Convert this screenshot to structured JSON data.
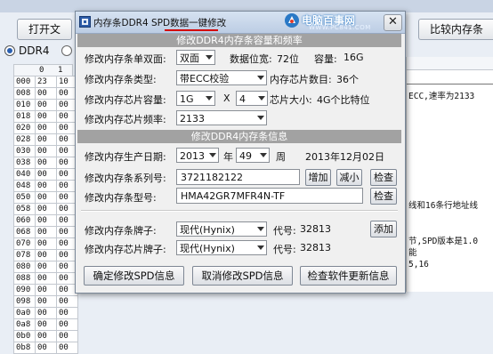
{
  "background": {
    "open_button": "打开文",
    "compare_button": "比较内存条",
    "ddr4_radio": "DDR4",
    "hex_header_cols": [
      "0",
      "1"
    ],
    "hex_rows": [
      [
        "000",
        "23",
        "10"
      ],
      [
        "008",
        "00",
        "00"
      ],
      [
        "010",
        "00",
        "00"
      ],
      [
        "018",
        "00",
        "00"
      ],
      [
        "020",
        "00",
        "00"
      ],
      [
        "028",
        "00",
        "00"
      ],
      [
        "030",
        "00",
        "00"
      ],
      [
        "038",
        "00",
        "00"
      ],
      [
        "040",
        "00",
        "00"
      ],
      [
        "048",
        "00",
        "00"
      ],
      [
        "050",
        "00",
        "00"
      ],
      [
        "058",
        "00",
        "00"
      ],
      [
        "060",
        "00",
        "00"
      ],
      [
        "068",
        "00",
        "00"
      ],
      [
        "070",
        "00",
        "00"
      ],
      [
        "078",
        "00",
        "00"
      ],
      [
        "080",
        "00",
        "00"
      ],
      [
        "088",
        "00",
        "00"
      ],
      [
        "090",
        "00",
        "00"
      ],
      [
        "098",
        "00",
        "00"
      ],
      [
        "0a0",
        "00",
        "00"
      ],
      [
        "0a8",
        "00",
        "00"
      ],
      [
        "0b0",
        "00",
        "00"
      ],
      [
        "0b8",
        "00",
        "00"
      ]
    ],
    "hex_rows_visible": [
      [
        "000",
        "23",
        "10"
      ],
      [
        "008",
        "00",
        "00"
      ],
      [
        "010",
        "00",
        "00"
      ],
      [
        "018",
        "00",
        "00"
      ],
      [
        "020",
        "00",
        "00"
      ],
      [
        "028",
        "00",
        "00"
      ],
      [
        "030",
        "00",
        "00"
      ],
      [
        "038",
        "00",
        "00"
      ],
      [
        "040",
        "00",
        "00"
      ],
      [
        "048",
        "00",
        "00"
      ],
      [
        "050",
        "00",
        "00"
      ],
      [
        "058",
        "00",
        "00"
      ],
      [
        "060",
        "00",
        "00"
      ],
      [
        "068",
        "00",
        "00"
      ],
      [
        "070",
        "00",
        "00"
      ],
      [
        "078",
        "00",
        "00"
      ],
      [
        "080",
        "00",
        "00"
      ],
      [
        "088",
        "00",
        "00"
      ],
      [
        "090",
        "00",
        "00"
      ],
      [
        "098",
        "00",
        "00"
      ],
      [
        "0a0",
        "00",
        "00"
      ],
      [
        "0a8",
        "00",
        "00"
      ],
      [
        "0b0",
        "00",
        "00"
      ],
      [
        "0b8",
        "00",
        "00"
      ]
    ],
    "right_text_1": "ECC,速率为2133",
    "right_text_2": "线和16条行地址线",
    "right_text_3": "节,SPD版本是1.0",
    "right_text_4": "能",
    "right_text_5": "5,16"
  },
  "dialog": {
    "title": "内存条DDR4 SPD数据一键修改",
    "watermark_text": "电脑百事网",
    "watermark_url": "WWW.PC841.COM",
    "close_label": "✕",
    "section1_title": "修改DDR4内存条容量和频率",
    "rank_label": "修改内存条单双面:",
    "rank_value": "双面",
    "data_width_label": "数据位宽:",
    "data_width_value": "72位",
    "capacity_label": "容量:",
    "capacity_value": "16G",
    "type_label": "修改内存条类型:",
    "type_value": "带ECC校验",
    "chip_count_label": "内存芯片数目:",
    "chip_count_value": "36个",
    "chip_capacity_label": "修改内存芯片容量:",
    "chip_capacity_value": "1G",
    "times_label": "X",
    "chip_multiplier_value": "4",
    "chip_size_label": "芯片大小:",
    "chip_size_value": "4G个比特位",
    "frequency_label": "修改内存芯片频率:",
    "frequency_value": "2133",
    "section2_title": "修改DDR4内存条信息",
    "date_label": "修改内存生产日期:",
    "year_value": "2013",
    "year_unit": "年",
    "week_value": "49",
    "week_unit": "周",
    "date_display": "2013年12月02日",
    "serial_label": "修改内存条系列号:",
    "serial_value": "3721182122",
    "increase_label": "增加",
    "decrease_label": "减小",
    "check_label": "检查",
    "model_label": "修改内存条型号:",
    "model_value": "HMA42GR7MFR4N-TF",
    "model_check_label": "检查",
    "module_brand_label": "修改内存条牌子:",
    "module_brand_value": "现代(Hynix)",
    "module_code_label": "代号:",
    "module_code_value": "32813",
    "add_label": "添加",
    "chip_brand_label": "修改内存芯片牌子:",
    "chip_brand_value": "现代(Hynix)",
    "chip_code_label": "代号:",
    "chip_code_value": "32813",
    "confirm_label": "确定修改SPD信息",
    "cancel_label": "取消修改SPD信息",
    "update_label": "检查软件更新信息"
  },
  "colors": {
    "section_bar": "#a2a2a2",
    "title_underline": "#d40000",
    "watermark_blue": "#2a79c6"
  }
}
